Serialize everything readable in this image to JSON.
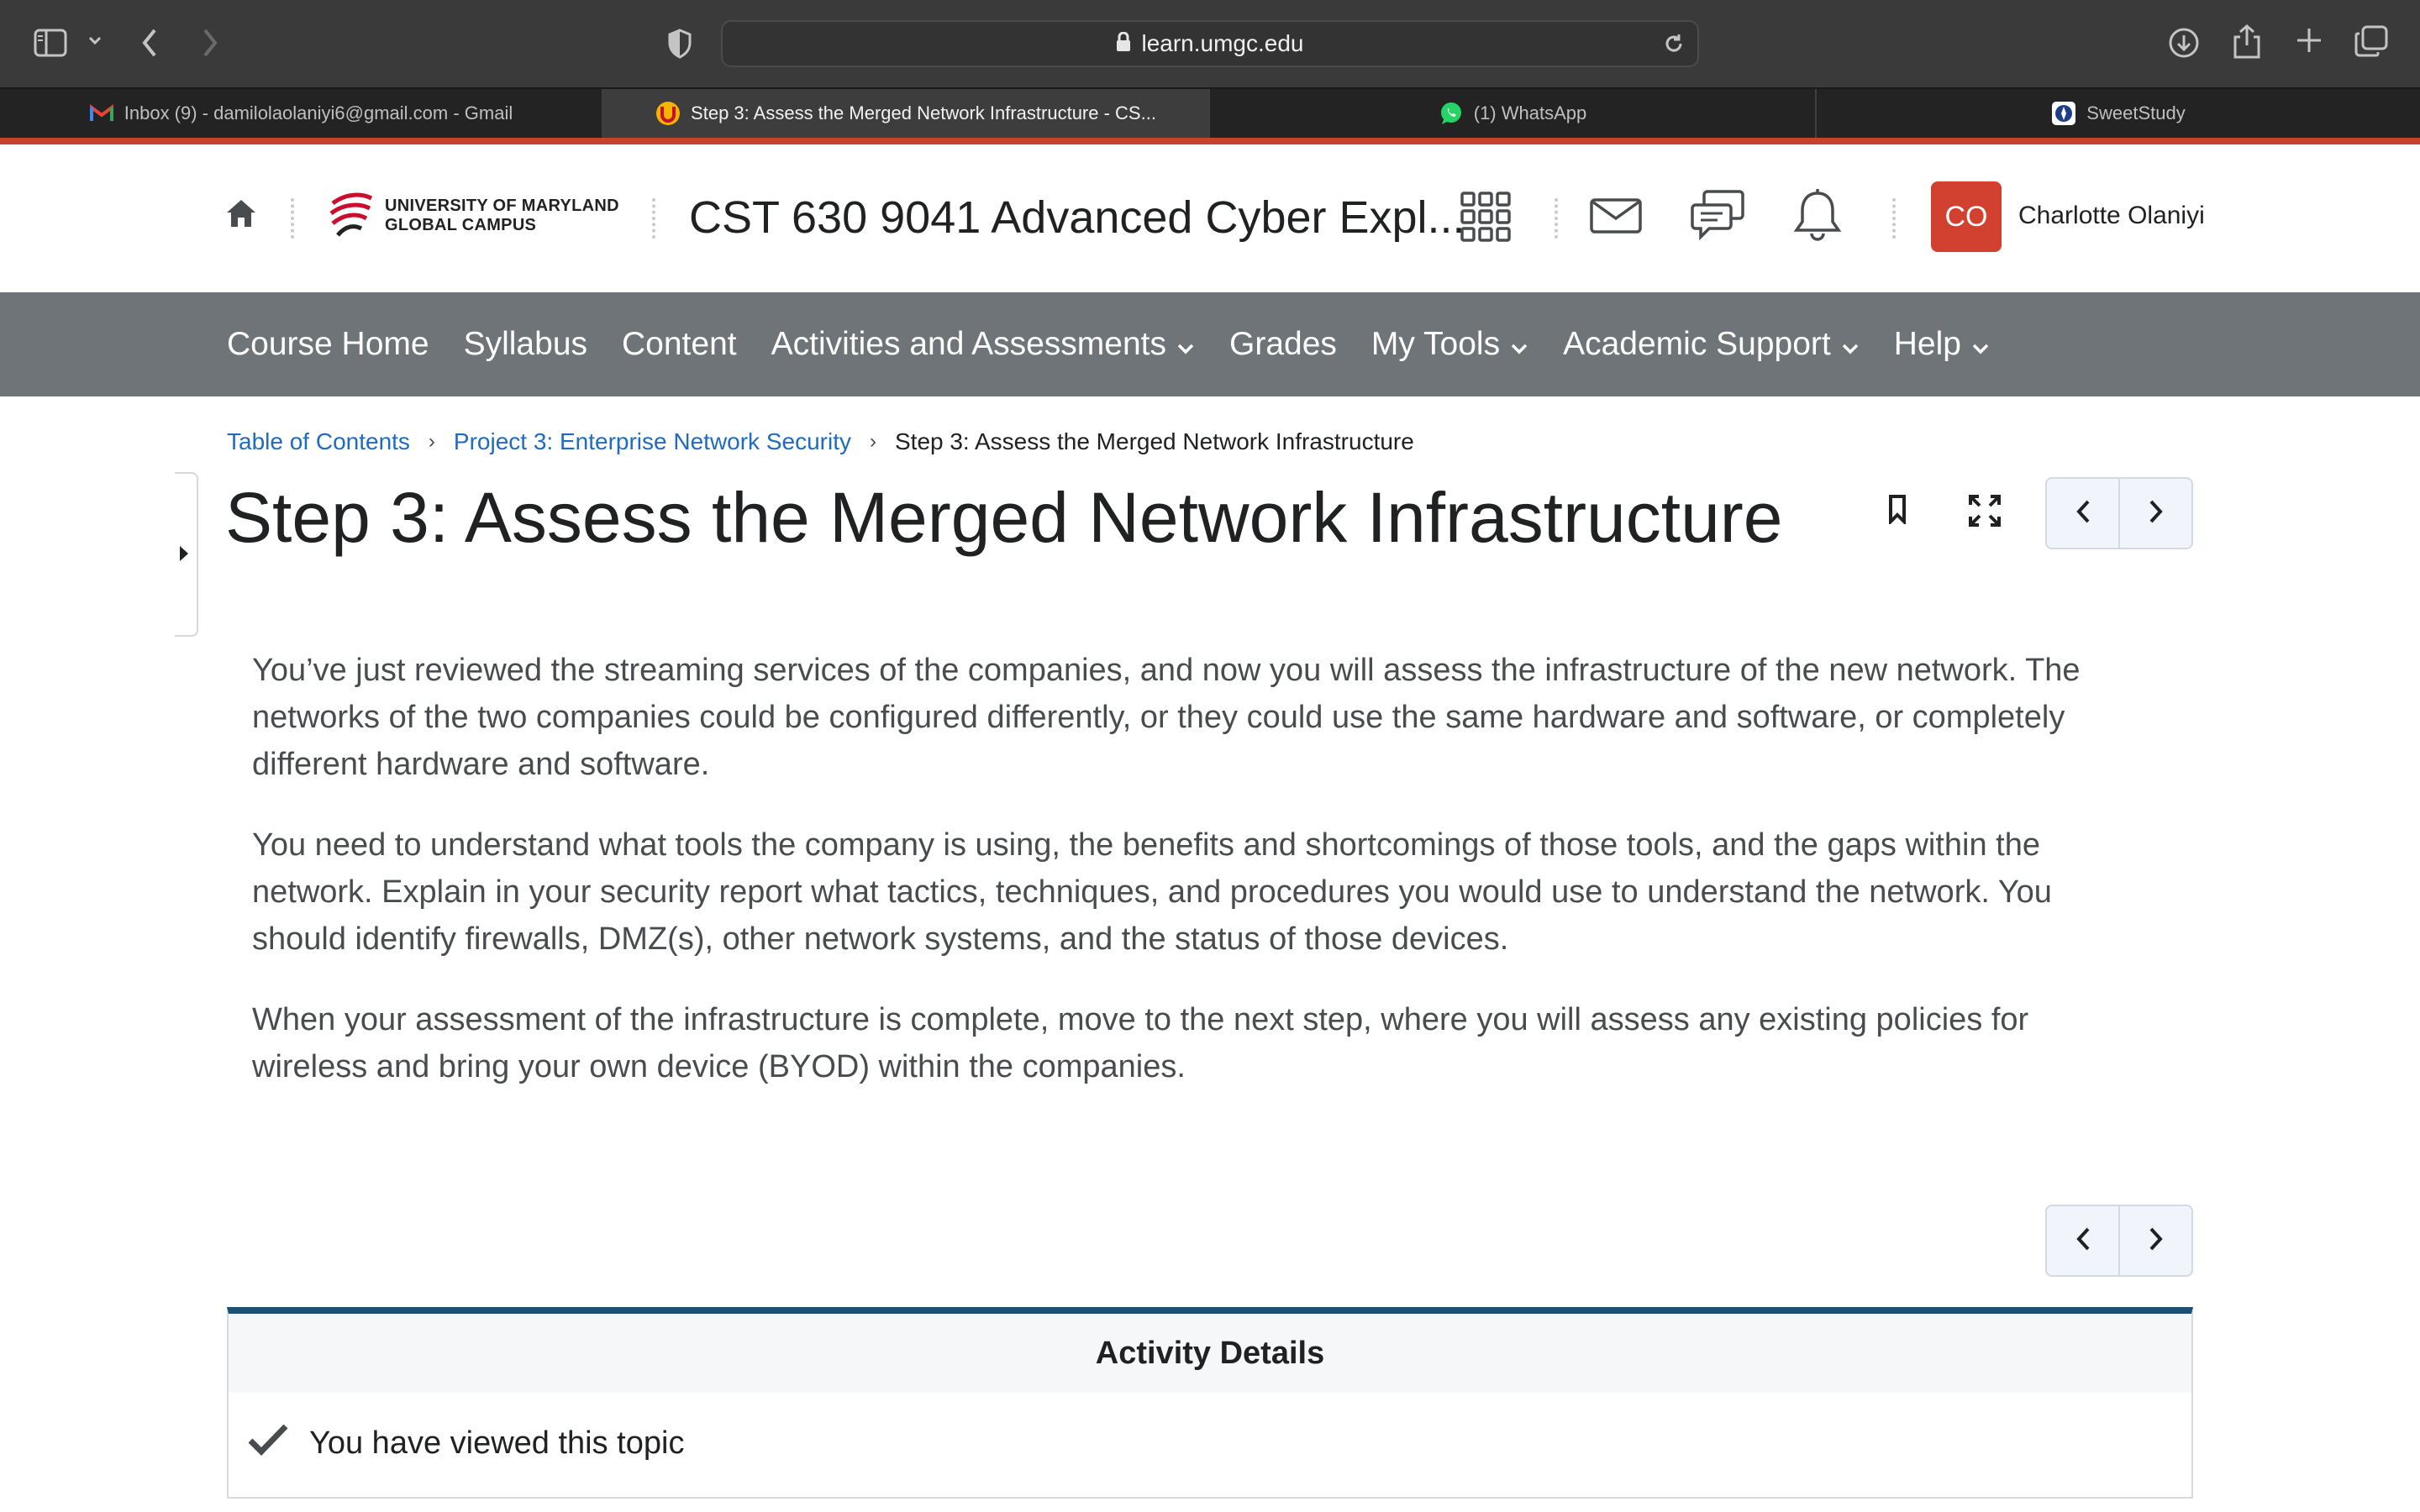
{
  "browser": {
    "address": "learn.umgc.edu",
    "tabs": [
      {
        "label": "Inbox (9) - damilolaolaniyi6@gmail.com - Gmail",
        "active": false,
        "favicon": "gmail-icon"
      },
      {
        "label": "Step 3: Assess the Merged Network Infrastructure - CS...",
        "active": true,
        "favicon": "umgc-icon"
      },
      {
        "label": "(1) WhatsApp",
        "active": false,
        "favicon": "whatsapp-icon"
      },
      {
        "label": "SweetStudy",
        "active": false,
        "favicon": "sweetstudy-icon"
      }
    ]
  },
  "header": {
    "logo_line1": "UNIVERSITY OF MARYLAND",
    "logo_line2": "GLOBAL CAMPUS",
    "course_title": "CST 630 9041 Advanced Cyber Expl...",
    "avatar_initials": "CO",
    "user_name": "Charlotte Olaniyi",
    "accent_color": "#c8412b",
    "avatar_color": "#d2402f"
  },
  "nav": {
    "items": [
      {
        "label": "Course Home",
        "has_menu": false
      },
      {
        "label": "Syllabus",
        "has_menu": false
      },
      {
        "label": "Content",
        "has_menu": false
      },
      {
        "label": "Activities and Assessments",
        "has_menu": true
      },
      {
        "label": "Grades",
        "has_menu": false
      },
      {
        "label": "My Tools",
        "has_menu": true
      },
      {
        "label": "Academic Support",
        "has_menu": true
      },
      {
        "label": "Help",
        "has_menu": true
      }
    ],
    "bar_color": "#6e7477"
  },
  "breadcrumb": {
    "items": [
      "Table of Contents",
      "Project 3: Enterprise Network Security"
    ],
    "current": "Step 3: Assess the Merged Network Infrastructure"
  },
  "page": {
    "title": "Step 3: Assess the Merged Network Infrastructure",
    "paragraphs": [
      "You’ve just reviewed the streaming services of the companies, and now you will assess the infrastructure of the new network. The networks of the two companies could be configured differently, or they could use the same hardware and software, or completely different hardware and software.",
      "You need to understand what tools the company is using, the benefits and shortcomings of those tools, and the gaps within the network. Explain in your security report what tactics, techniques, and procedures you would use to understand the network. You should identify firewalls, DMZ(s), other network systems, and the status of those devices.",
      "When your assessment of the infrastructure is complete, move to the next step, where you will assess any existing policies for wireless and bring your own device (BYOD) within the companies."
    ]
  },
  "activity": {
    "heading": "Activity Details",
    "status": "You have viewed this topic",
    "border_color": "#1c5074"
  }
}
